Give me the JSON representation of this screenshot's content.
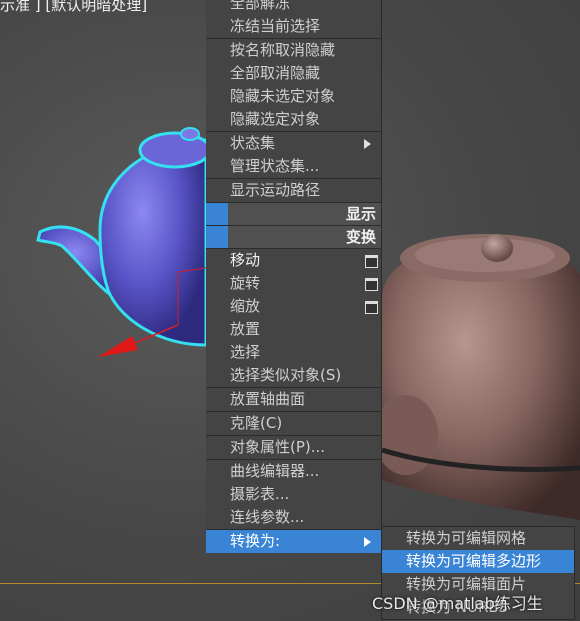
{
  "viewport": {
    "label": "示准 ] [默认明暗处理]"
  },
  "menu": {
    "items": [
      {
        "label": "全部解冻"
      },
      {
        "label": "冻结当前选择"
      },
      {
        "label": "按名称取消隐藏"
      },
      {
        "label": "全部取消隐藏"
      },
      {
        "label": "隐藏未选定对象"
      },
      {
        "label": "隐藏选定对象"
      },
      {
        "label": "状态集"
      },
      {
        "label": "管理状态集..."
      },
      {
        "label": "显示运动路径"
      },
      {
        "label": "移动"
      },
      {
        "label": "旋转"
      },
      {
        "label": "缩放"
      },
      {
        "label": "放置"
      },
      {
        "label": "选择"
      },
      {
        "label": "选择类似对象(S)"
      },
      {
        "label": "放置轴曲面"
      },
      {
        "label": "克隆(C)"
      },
      {
        "label": "对象属性(P)..."
      },
      {
        "label": "曲线编辑器..."
      },
      {
        "label": "摄影表..."
      },
      {
        "label": "连线参数..."
      },
      {
        "label": "转换为:"
      }
    ],
    "sections": {
      "display": "显示",
      "transform": "变换"
    }
  },
  "submenu": {
    "items": [
      {
        "label": "转换为可编辑网格"
      },
      {
        "label": "转换为可编辑多边形"
      },
      {
        "label": "转换为可编辑面片"
      },
      {
        "label": "转换为 NURBS"
      }
    ]
  },
  "watermark": "CSDN @matlab练习生",
  "colors": {
    "highlight": "#3a84d6",
    "menu_bg": "#444444",
    "selection_outline": "#35e0f0",
    "teapot_blue": "#5a55c8"
  }
}
